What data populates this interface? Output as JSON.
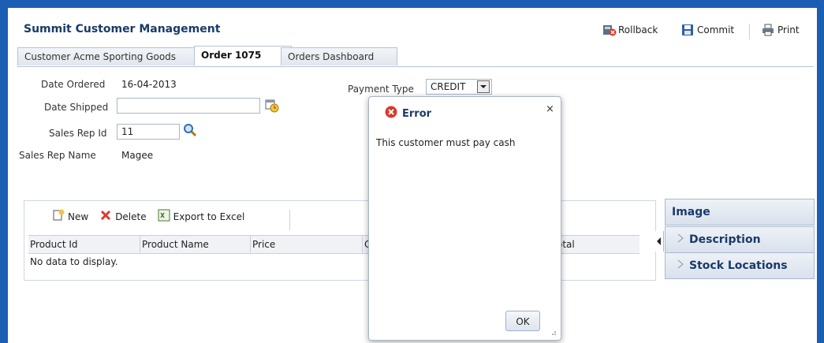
{
  "app": {
    "title": "Summit Customer Management",
    "toolbar": {
      "rollback": "Rollback",
      "commit": "Commit",
      "print": "Print"
    }
  },
  "tabs": [
    "Customer Acme Sporting Goods",
    "Order 1075",
    "Orders Dashboard"
  ],
  "form": {
    "date_ordered_label": "Date Ordered",
    "date_ordered_value": "16-04-2013",
    "date_shipped_label": "Date Shipped",
    "date_shipped_value": "",
    "sales_rep_id_label": "Sales Rep Id",
    "sales_rep_id_value": "11",
    "sales_rep_name_label": "Sales Rep Name",
    "sales_rep_name_value": "Magee",
    "payment_type_label": "Payment Type",
    "payment_type_value": "CREDIT"
  },
  "items_toolbar": {
    "new": "New",
    "delete": "Delete",
    "export": "Export to Excel"
  },
  "table": {
    "columns": [
      "Product Id",
      "Product Name",
      "Price",
      "C",
      "otal"
    ],
    "empty_text": "No data to display."
  },
  "accordion": [
    "Image",
    "Description",
    "Stock Locations"
  ],
  "dialog": {
    "title": "Error",
    "message": "This customer must pay cash",
    "ok": "OK",
    "close": "×"
  },
  "colors": {
    "frame": "#1a5fb4",
    "title": "#1a3a6a",
    "error": "#d93a2b"
  }
}
